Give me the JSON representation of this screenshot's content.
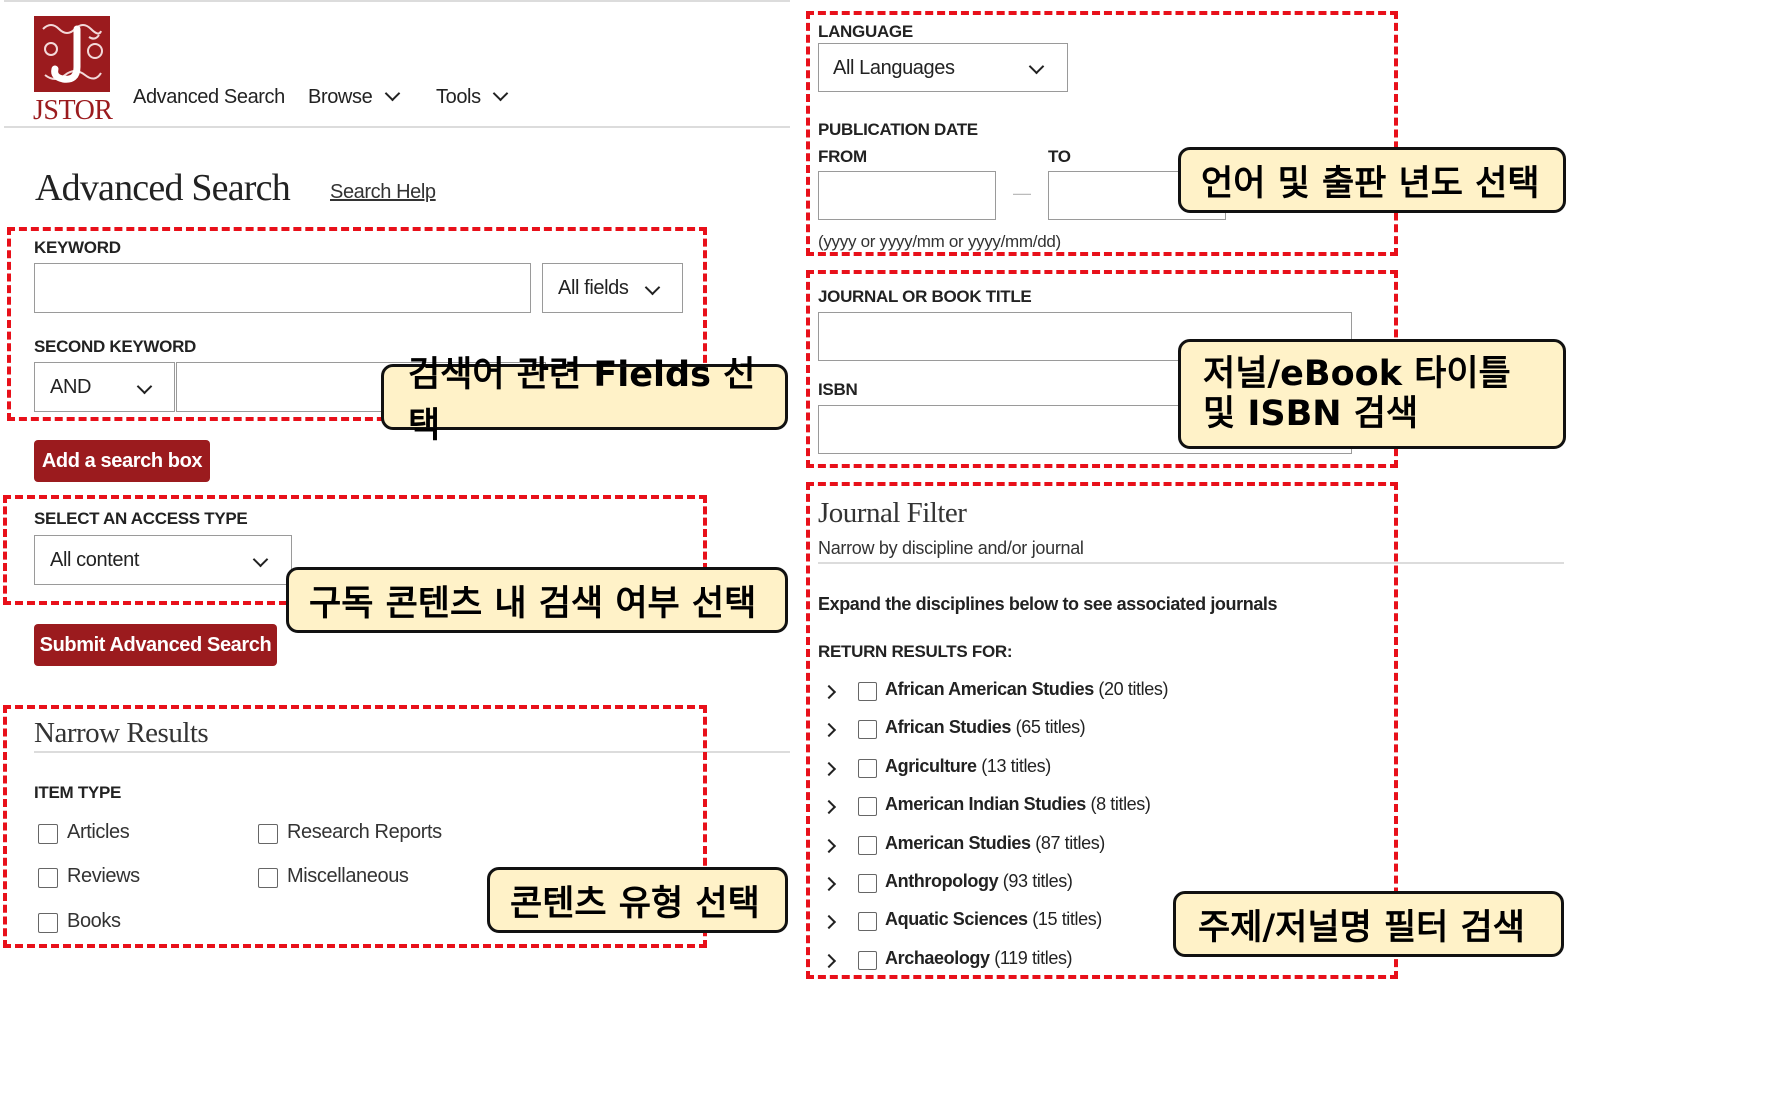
{
  "nav": {
    "logo_text": "JSTOR",
    "items": [
      {
        "label": "Advanced Search"
      },
      {
        "label": "Browse"
      },
      {
        "label": "Tools"
      }
    ]
  },
  "page": {
    "title": "Advanced Search",
    "help_link": "Search Help"
  },
  "keyword": {
    "label": "KEYWORD",
    "value": "",
    "field_select": "All fields",
    "second_label": "SECOND KEYWORD",
    "operator_select": "AND",
    "second_value": ""
  },
  "add_search_box": "Add a search box",
  "access": {
    "label": "SELECT AN ACCESS TYPE",
    "select": "All content"
  },
  "submit": "Submit Advanced Search",
  "narrow": {
    "title": "Narrow Results",
    "item_type_label": "ITEM TYPE",
    "items": [
      {
        "label": "Articles",
        "checked": false
      },
      {
        "label": "Research Reports",
        "checked": false
      },
      {
        "label": "Reviews",
        "checked": false
      },
      {
        "label": "Miscellaneous",
        "checked": false
      },
      {
        "label": "Books",
        "checked": false
      }
    ]
  },
  "language": {
    "label": "LANGUAGE",
    "select": "All Languages"
  },
  "pubdate": {
    "label": "PUBLICATION DATE",
    "from_label": "FROM",
    "to_label": "TO",
    "from_value": "",
    "to_value": "",
    "separator": "—",
    "hint": "(yyyy or yyyy/mm or yyyy/mm/dd)"
  },
  "journal_title": {
    "label": "JOURNAL OR BOOK TITLE",
    "value": ""
  },
  "isbn": {
    "label": "ISBN",
    "value": ""
  },
  "journal_filter": {
    "title": "Journal Filter",
    "subtitle": "Narrow by discipline and/or journal",
    "expand_note": "Expand the disciplines below to see associated journals",
    "return_label": "RETURN RESULTS FOR:",
    "disciplines": [
      {
        "name": "African American Studies",
        "count": "(20 titles)",
        "checked": false
      },
      {
        "name": "African Studies",
        "count": "(65 titles)",
        "checked": false
      },
      {
        "name": "Agriculture",
        "count": "(13 titles)",
        "checked": false
      },
      {
        "name": "American Indian Studies",
        "count": "(8 titles)",
        "checked": false
      },
      {
        "name": "American Studies",
        "count": "(87 titles)",
        "checked": false
      },
      {
        "name": "Anthropology",
        "count": "(93 titles)",
        "checked": false
      },
      {
        "name": "Aquatic Sciences",
        "count": "(15 titles)",
        "checked": false
      },
      {
        "name": "Archaeology",
        "count": "(119 titles)",
        "checked": false
      }
    ]
  },
  "annotations": [
    {
      "text": "검색어 관련 Fields 선택"
    },
    {
      "text": "구독 콘텐츠 내 검색 여부 선택"
    },
    {
      "text": "콘텐츠 유형 선택"
    },
    {
      "text": "언어 및 출판 년도 선택"
    },
    {
      "text": "저널/eBook 타이틀\n및 ISBN 검색"
    },
    {
      "text": "주제/저널명 필터 검색"
    }
  ],
  "colors": {
    "brand": "#9b1b1e",
    "annotation_border": "#e8101a",
    "callout_fill": "#fff2c8"
  }
}
